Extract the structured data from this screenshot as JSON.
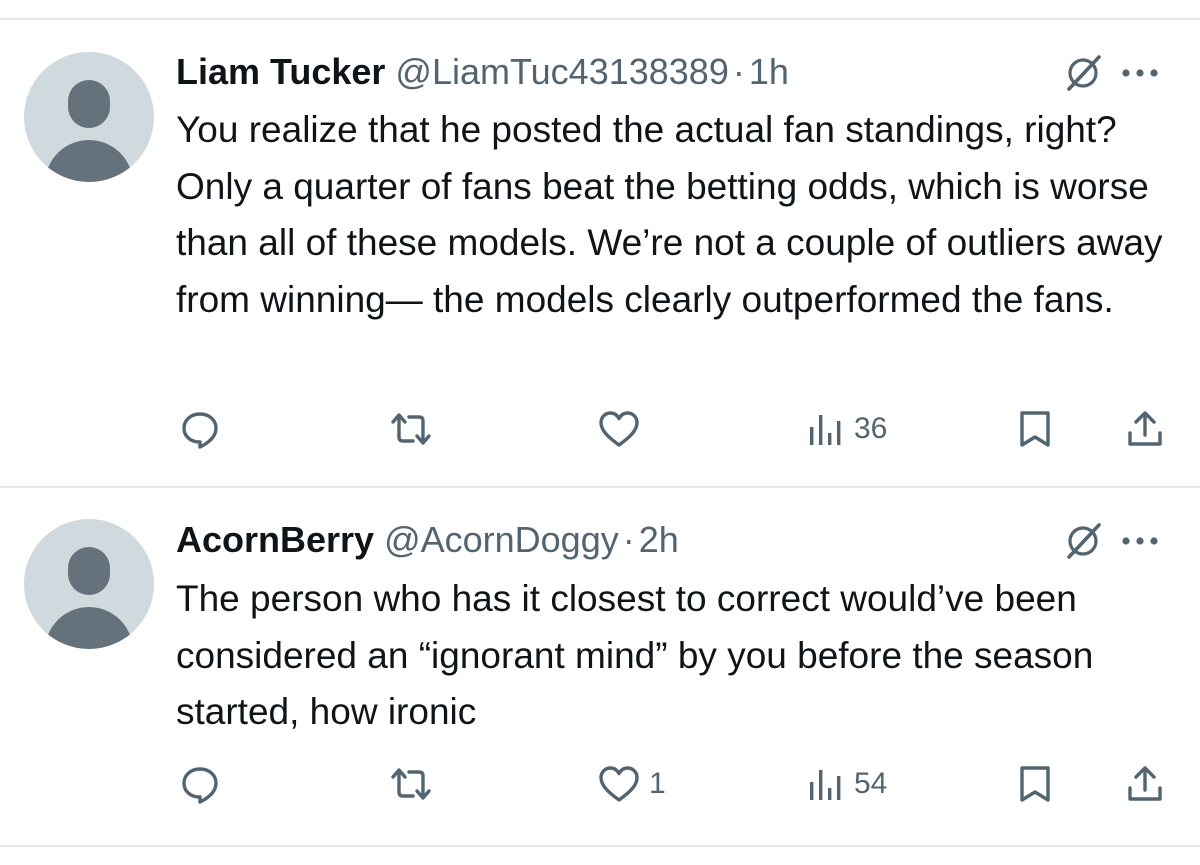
{
  "tweets": [
    {
      "name": "Liam Tucker",
      "handle": "@LiamTuc43138389",
      "separator": "·",
      "time": "1h",
      "text": "You realize that he posted the actual fan standings, right? Only a quarter of fans beat the betting odds, which is worse than all of these models. We’re not a couple of outliers away from winning— the models clearly outperformed the fans.",
      "replies": "",
      "retweets": "",
      "likes": "",
      "views": "36",
      "icons": [
        "reply-icon",
        "retweet-icon",
        "like-icon",
        "views-icon",
        "bookmark-icon",
        "share-icon",
        "grok-icon",
        "more-icon"
      ]
    },
    {
      "name": "AcornBerry",
      "handle": "@AcornDoggy",
      "separator": "·",
      "time": "2h",
      "text": "The person who has it closest to correct would’ve been considered an “ignorant mind” by you before the season started, how ironic",
      "replies": "",
      "retweets": "",
      "likes": "1",
      "views": "54",
      "icons": [
        "reply-icon",
        "retweet-icon",
        "like-icon",
        "views-icon",
        "bookmark-icon",
        "share-icon",
        "grok-icon",
        "more-icon"
      ]
    }
  ],
  "colors": {
    "text": "#0f1419",
    "secondary": "#536471",
    "avatar_bg": "#cfd9de",
    "avatar_fg": "#65717b",
    "divider": "#e4e7eb"
  }
}
